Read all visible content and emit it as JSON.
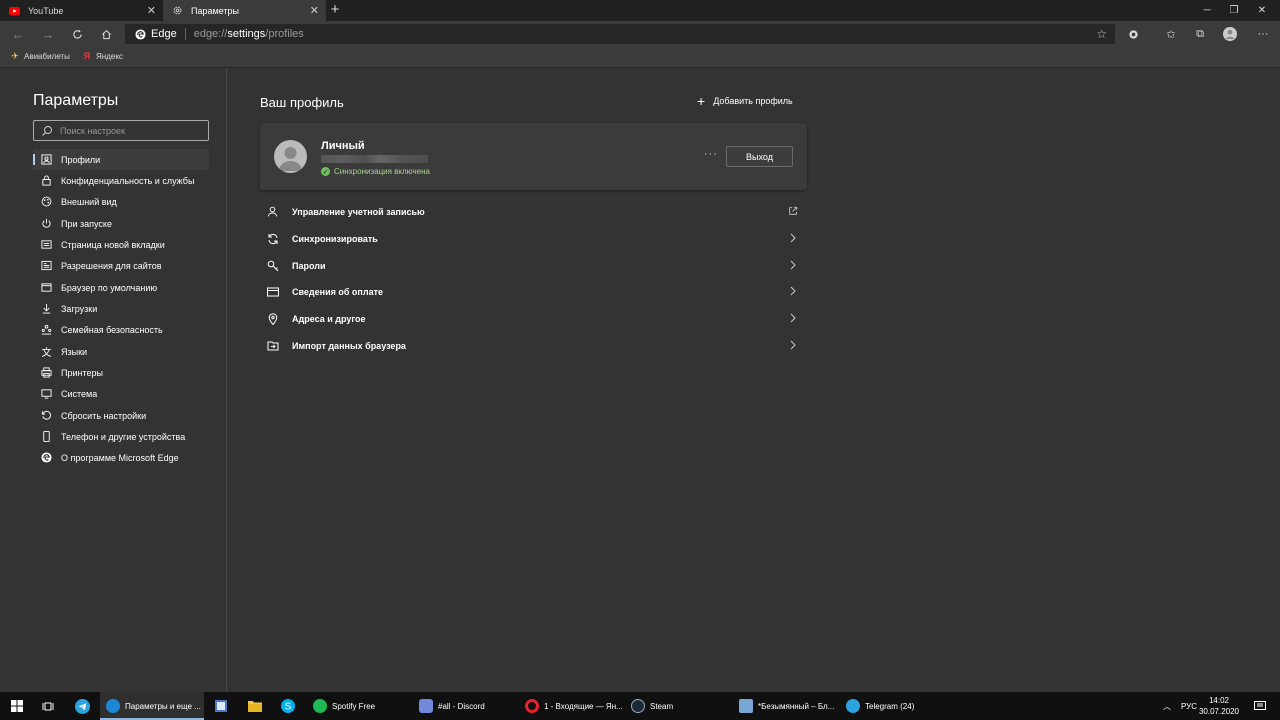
{
  "tabs": [
    {
      "label": "YouTube",
      "icon": "youtube-icon",
      "active": false
    },
    {
      "label": "Параметры",
      "icon": "gear-icon",
      "active": true
    }
  ],
  "address": {
    "site": "Edge",
    "url_prefix": "edge://",
    "url_bold": "settings",
    "url_suffix": "/profiles"
  },
  "bookmarks": [
    {
      "label": "Авиабилеты",
      "icon": "plane-icon"
    },
    {
      "label": "Яндекс",
      "icon": "yandex-icon"
    }
  ],
  "sidebar": {
    "title": "Параметры",
    "search_placeholder": "Поиск настроек",
    "items": [
      {
        "label": "Профили",
        "icon": "profile-icon",
        "selected": true
      },
      {
        "label": "Конфиденциальность и службы",
        "icon": "lock-icon"
      },
      {
        "label": "Внешний вид",
        "icon": "palette-icon"
      },
      {
        "label": "При запуске",
        "icon": "power-icon"
      },
      {
        "label": "Страница новой вкладки",
        "icon": "new-tab-page-icon"
      },
      {
        "label": "Разрешения для сайтов",
        "icon": "site-permissions-icon"
      },
      {
        "label": "Браузер по умолчанию",
        "icon": "default-browser-icon"
      },
      {
        "label": "Загрузки",
        "icon": "download-icon"
      },
      {
        "label": "Семейная безопасность",
        "icon": "family-icon"
      },
      {
        "label": "Языки",
        "icon": "language-icon"
      },
      {
        "label": "Принтеры",
        "icon": "printer-icon"
      },
      {
        "label": "Система",
        "icon": "system-icon"
      },
      {
        "label": "Сбросить настройки",
        "icon": "reset-icon"
      },
      {
        "label": "Телефон и другие устройства",
        "icon": "phone-icon"
      },
      {
        "label": "О программе Microsoft Edge",
        "icon": "edge-logo-icon"
      }
    ]
  },
  "main": {
    "title": "Ваш профиль",
    "add_profile": "Добавить профиль",
    "profile": {
      "name": "Личный",
      "sync_status": "Синхронизация включена",
      "more": "···",
      "logout": "Выход"
    },
    "rows": [
      {
        "label": "Управление учетной записью",
        "icon": "person-icon",
        "action": "external-link-icon"
      },
      {
        "label": "Синхронизировать",
        "icon": "sync-icon",
        "action": "chevron-right-icon"
      },
      {
        "label": "Пароли",
        "icon": "key-icon",
        "action": "chevron-right-icon"
      },
      {
        "label": "Сведения об оплате",
        "icon": "credit-card-icon",
        "action": "chevron-right-icon"
      },
      {
        "label": "Адреса и другое",
        "icon": "location-pin-icon",
        "action": "chevron-right-icon"
      },
      {
        "label": "Импорт данных браузера",
        "icon": "import-icon",
        "action": "chevron-right-icon"
      }
    ]
  },
  "taskbar": {
    "apps": [
      {
        "label": "Параметры и еще ...",
        "icon": "edge-icon",
        "color": "#1e88d8",
        "active": true
      },
      {
        "label": "Spotify Free",
        "icon": "spotify-icon",
        "color": "#1db954"
      },
      {
        "label": "#all - Discord",
        "icon": "discord-icon",
        "color": "#7289da"
      },
      {
        "label": "1 - Входящие — Ян...",
        "icon": "opera-icon",
        "color": "#e8212c"
      },
      {
        "label": "Steam",
        "icon": "steam-icon",
        "color": "#1b2838"
      },
      {
        "label": "*Безымянный – Бл...",
        "icon": "notepad-icon",
        "color": "#79a6d2"
      },
      {
        "label": "Telegram (24)",
        "icon": "telegram-icon",
        "color": "#2aa3de"
      }
    ],
    "lang": "РУС",
    "time": "14:02",
    "date": "30.07.2020"
  }
}
